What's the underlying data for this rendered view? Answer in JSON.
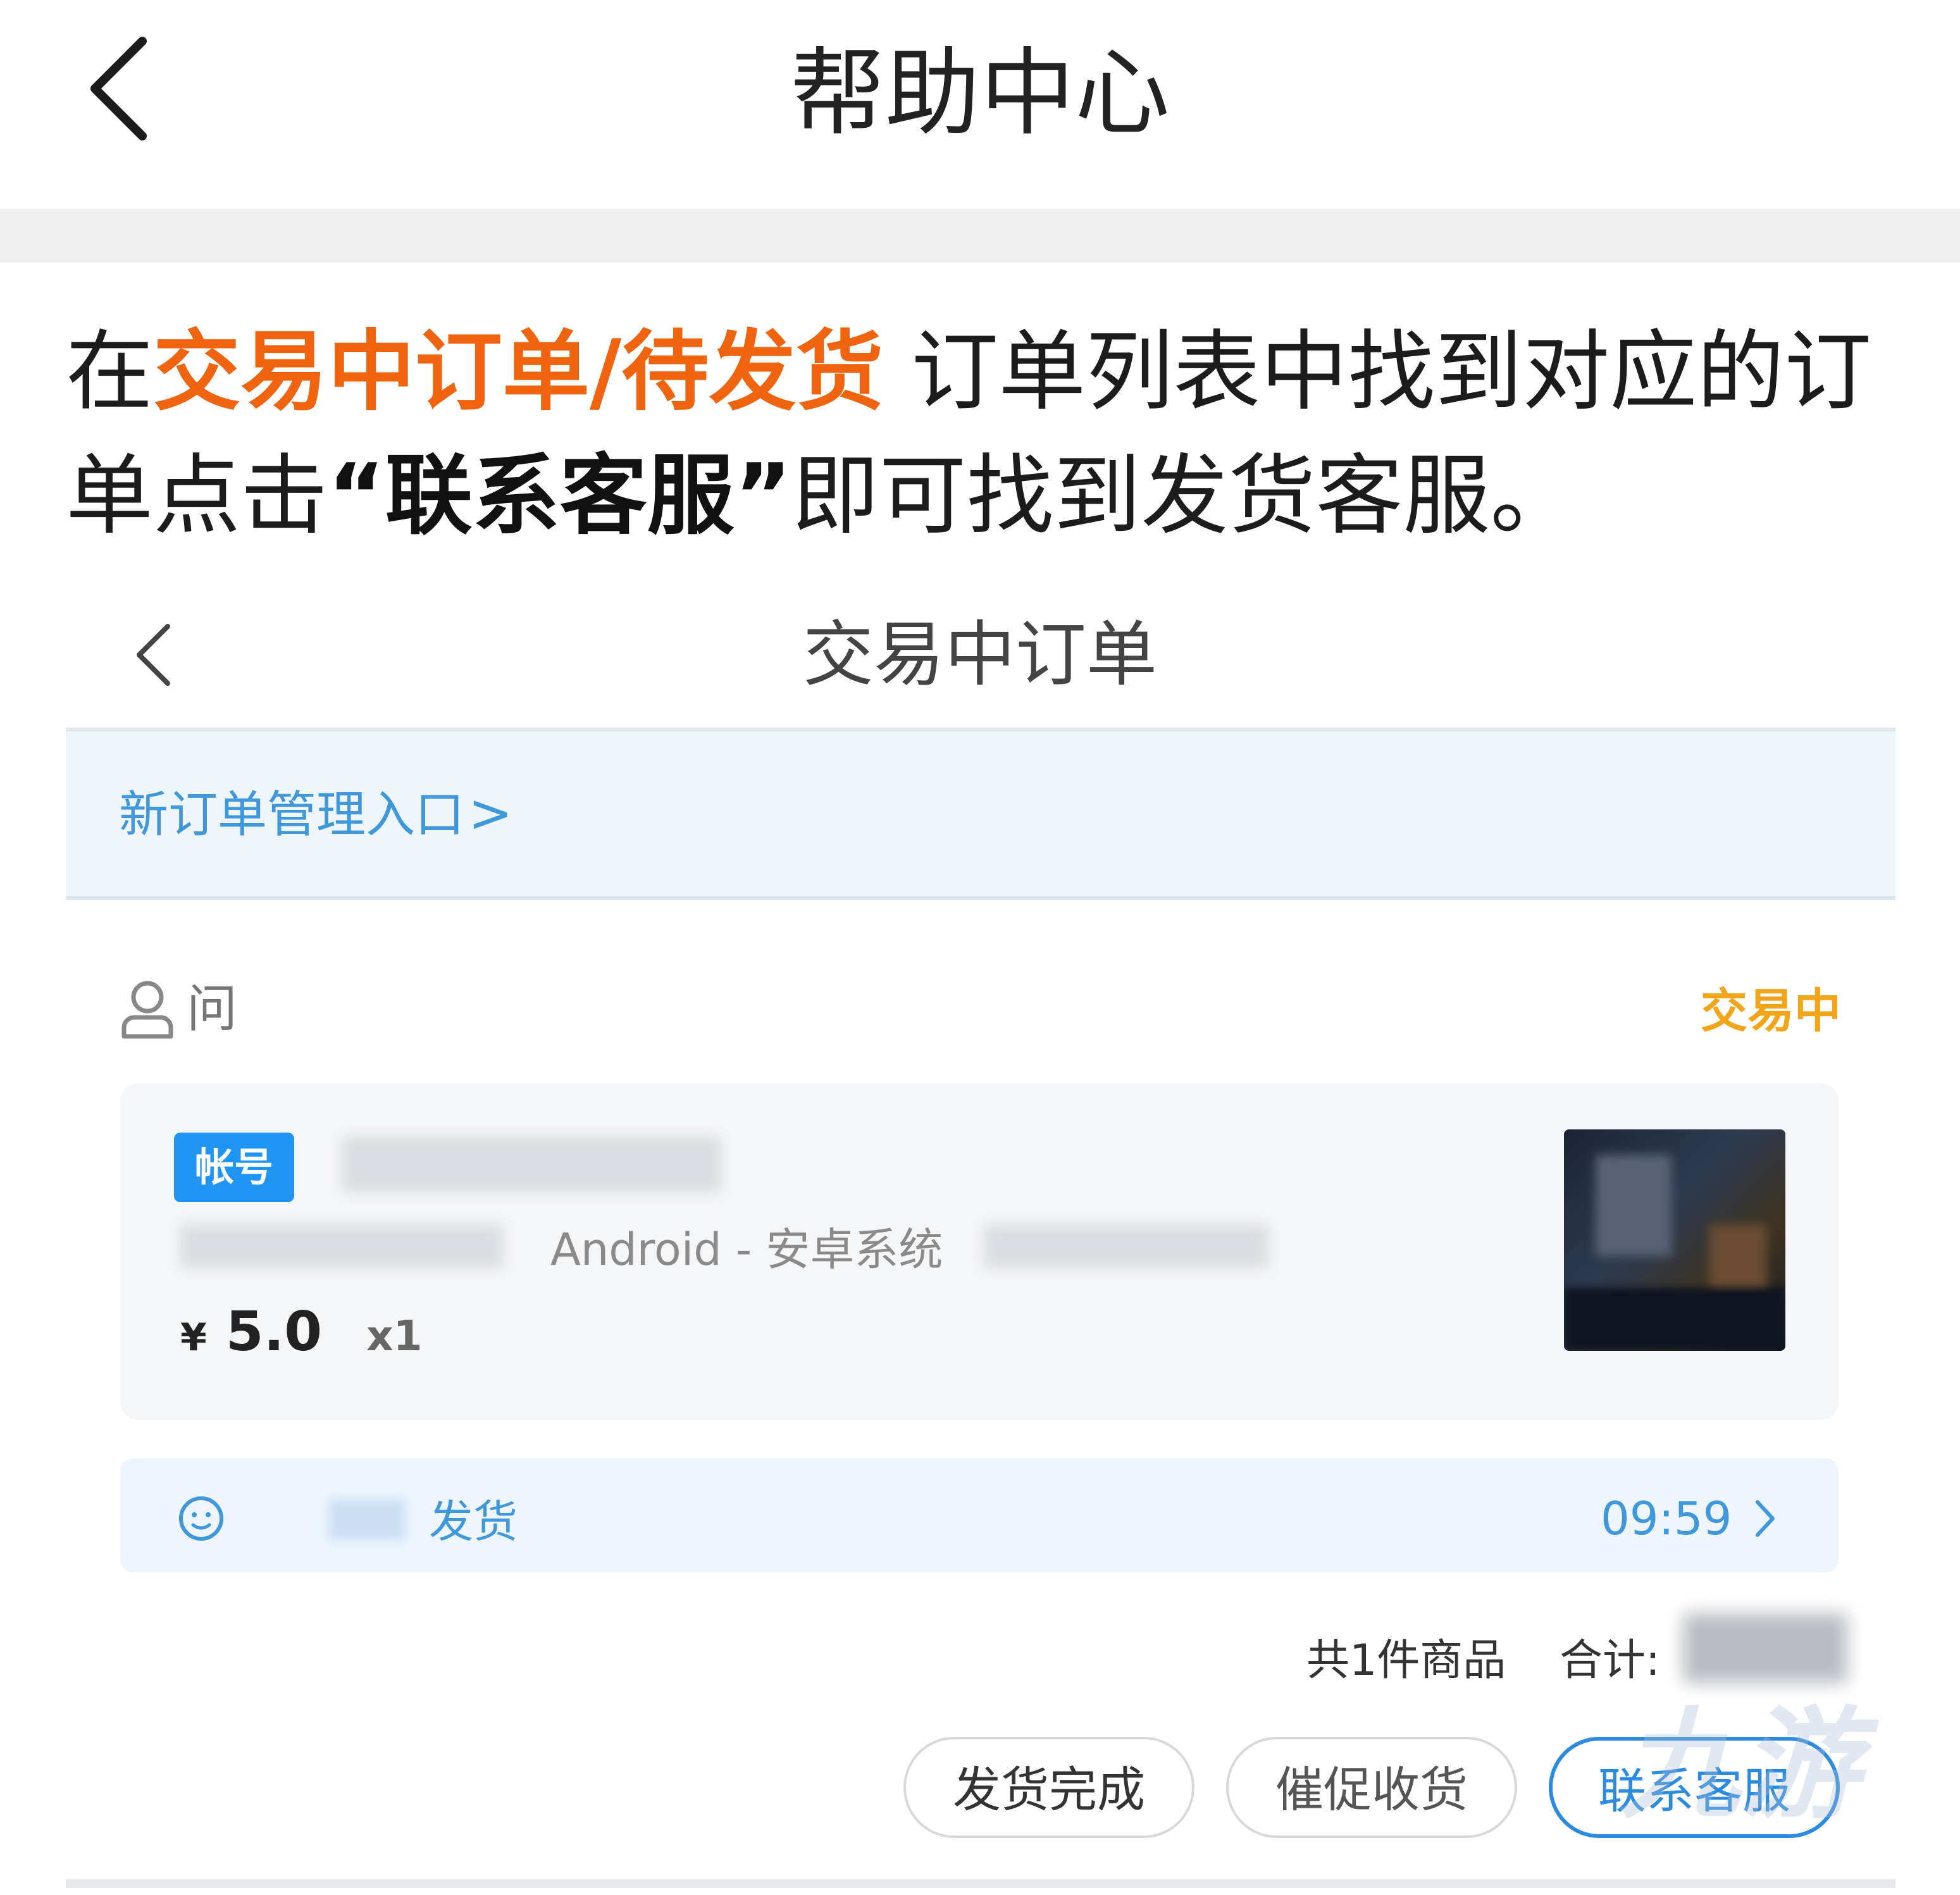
{
  "header": {
    "title": "帮助中心"
  },
  "instruction": {
    "prefix": "在",
    "highlight": "交易中订单/待发货",
    "middle": " 订单列表中找到对应的订单点击",
    "quote_open": "“",
    "bold": "联系客服",
    "quote_close": "”",
    "suffix": "即可找到发货客服。"
  },
  "orders_page": {
    "title": "交易中订单",
    "banner_link": "新订单管理入口",
    "banner_chevron": ">",
    "seller_name": "问",
    "status": "交易中",
    "item": {
      "badge": "帐号",
      "platform": "Android - 安卓系统",
      "currency": "¥",
      "price": "5.0",
      "quantity": "x1"
    },
    "shipping": {
      "text": "发货",
      "time": "09:59"
    },
    "summary": {
      "count_text": "共1件商品",
      "total_label": "合计:"
    },
    "buttons": {
      "done": "发货完成",
      "urge": "催促收货",
      "contact": "联系客服"
    },
    "watermark": "九游"
  },
  "colors": {
    "accent_orange": "#f0640f",
    "status_yellow": "#f2a518",
    "link_blue": "#3f97dc",
    "badge_blue": "#1e95f2"
  },
  "icons": [
    "back-chevron-icon",
    "user-icon",
    "smile-icon",
    "chevron-right-icon"
  ]
}
